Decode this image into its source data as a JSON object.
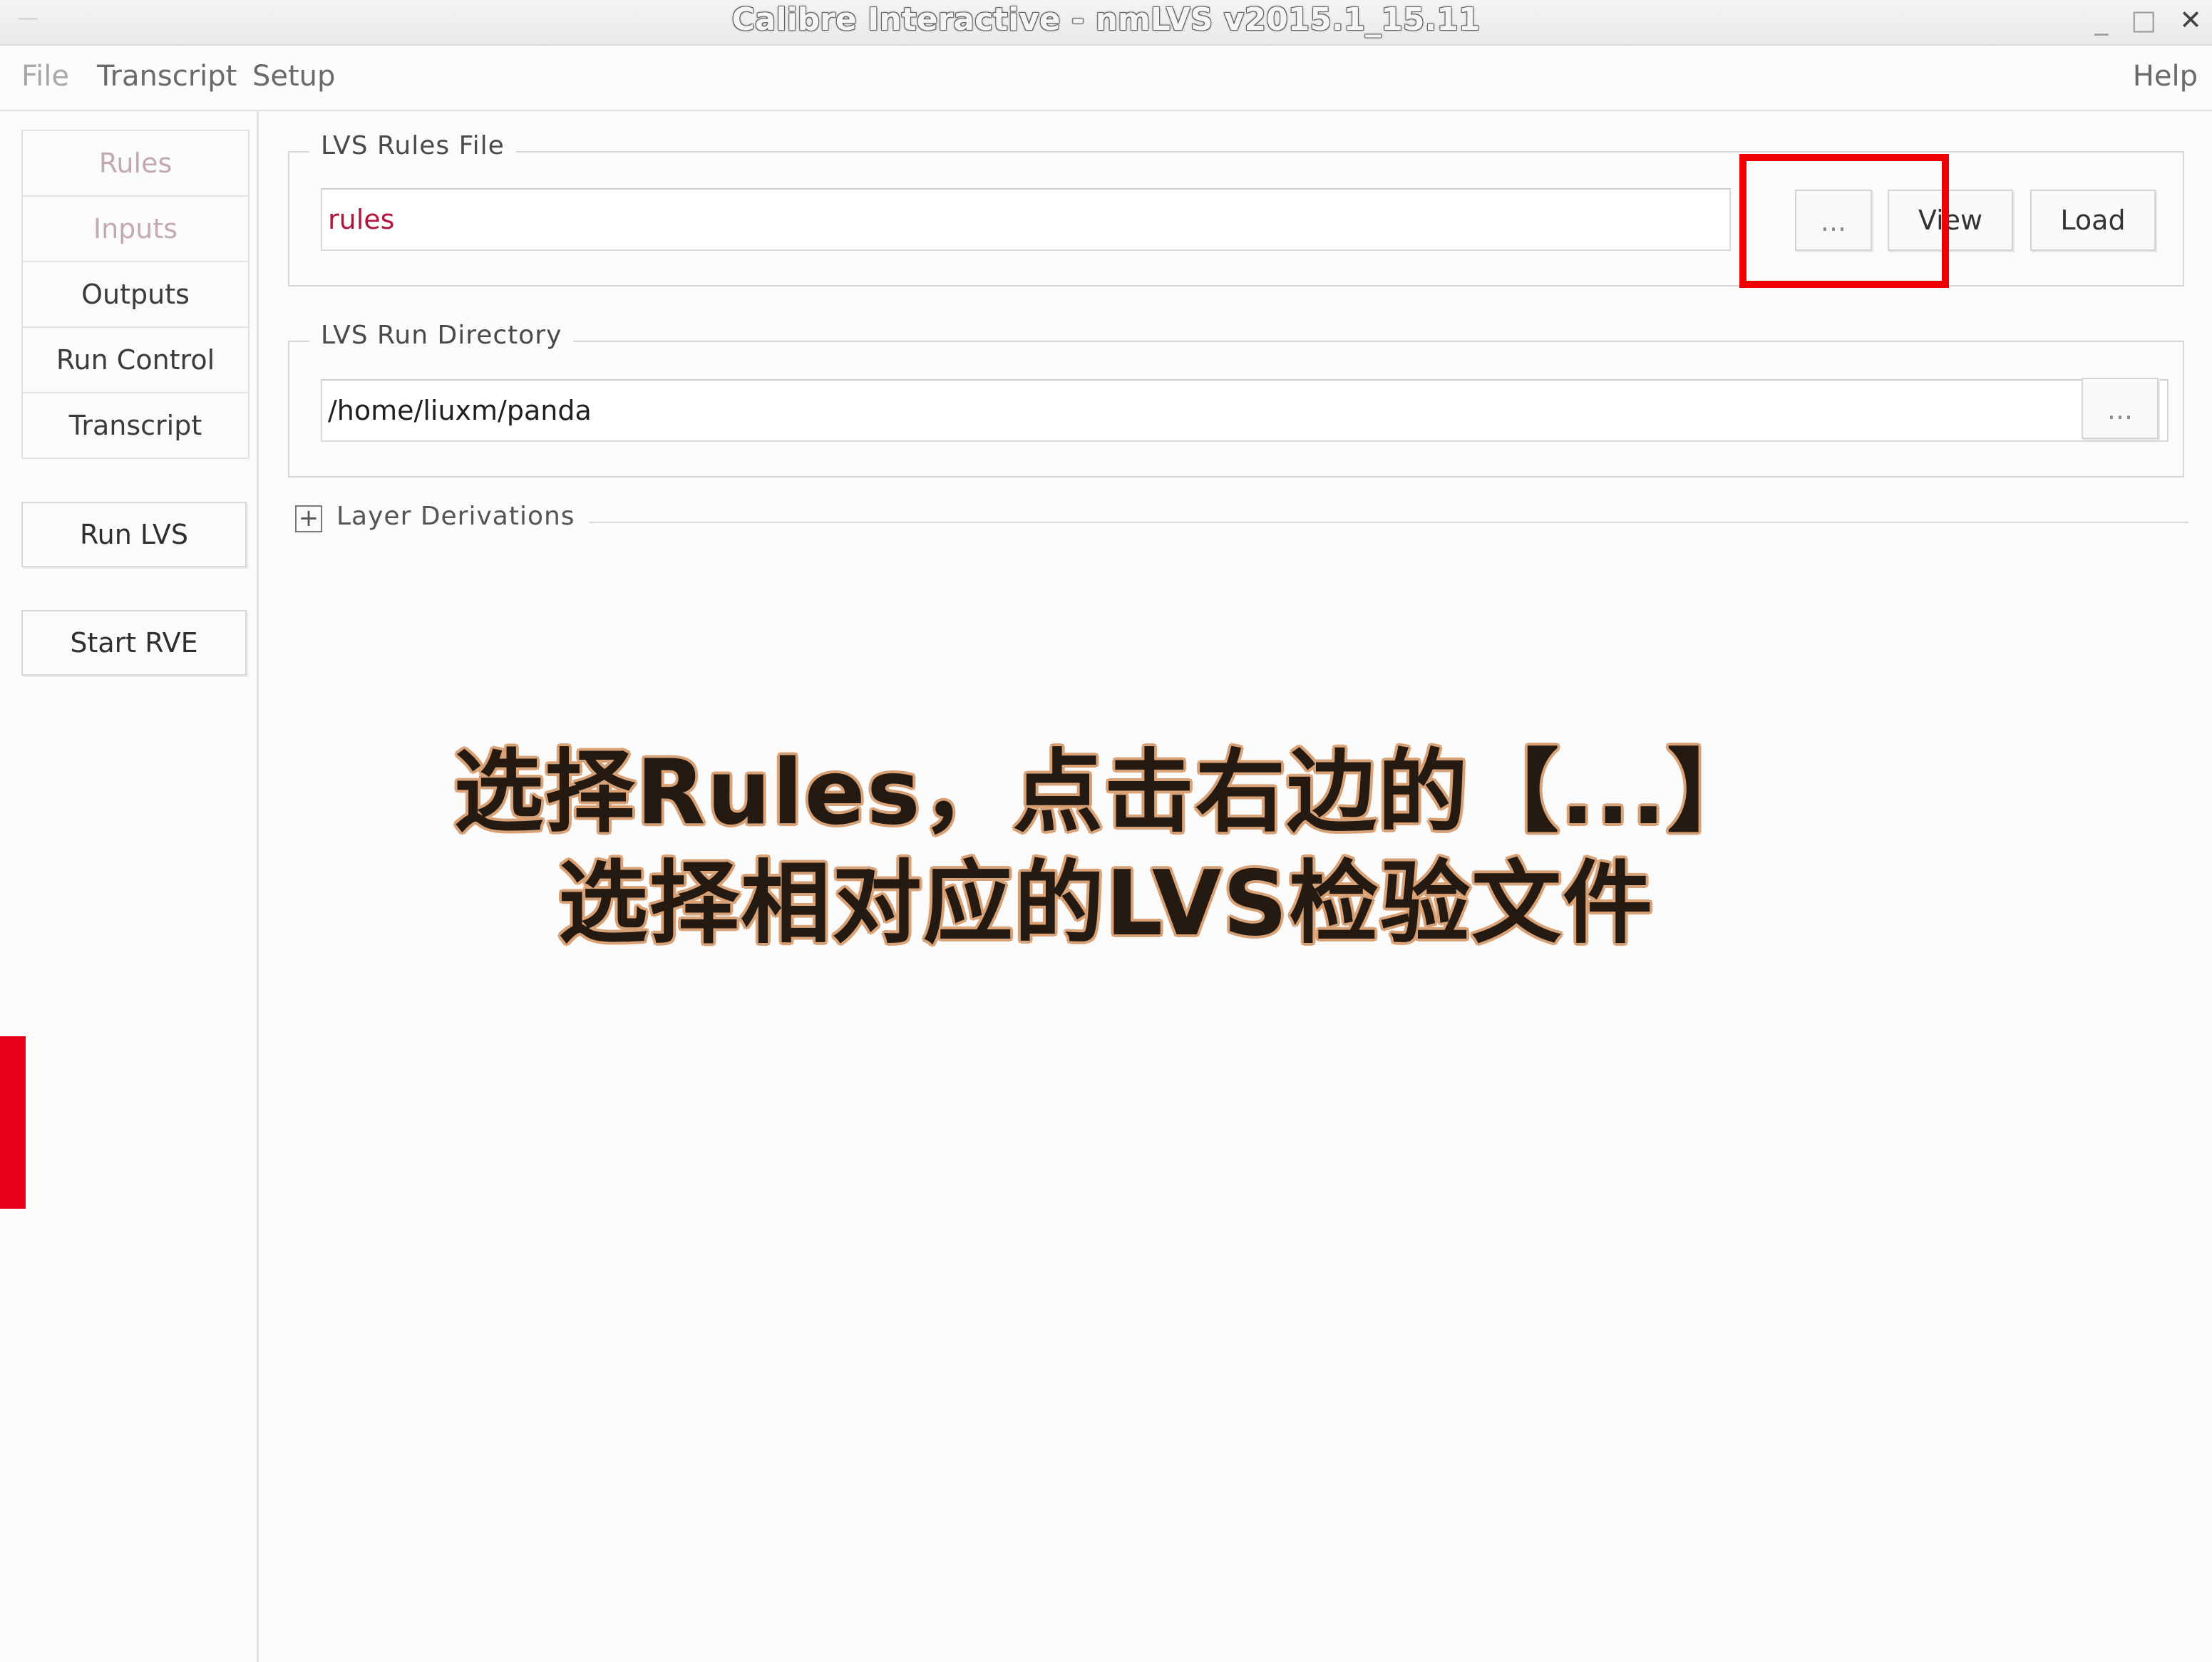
{
  "window": {
    "title": "Calibre Interactive - nmLVS v2015.1_15.11",
    "controls": {
      "minimize": "_",
      "maximize": "□",
      "close": "✕"
    }
  },
  "menubar": {
    "file": "File",
    "transcript": "Transcript",
    "setup": "Setup",
    "help": "Help"
  },
  "sidebar": {
    "items": [
      {
        "label": "Rules",
        "state": "disabled"
      },
      {
        "label": "Inputs",
        "state": "disabled"
      },
      {
        "label": "Outputs",
        "state": "normal"
      },
      {
        "label": "Run Control",
        "state": "normal"
      },
      {
        "label": "Transcript",
        "state": "normal"
      }
    ],
    "run_button": "Run LVS",
    "rve_button": "Start RVE"
  },
  "rules_file": {
    "label": "LVS Rules File",
    "value": "rules",
    "browse_label": "...",
    "view_label": "View",
    "load_label": "Load"
  },
  "run_directory": {
    "label": "LVS Run Directory",
    "value": "/home/liuxm/panda",
    "browse_label": "..."
  },
  "layer_derivations": {
    "expand_symbol": "+",
    "label": "Layer Derivations"
  },
  "annotation": {
    "line1": "选择Rules，点击右边的【...】",
    "line2": "选择相对应的LVS检验文件"
  },
  "colors": {
    "highlight": "#ee0000",
    "rules_value_text": "#b0153d",
    "side_marker": "#e8001a"
  }
}
